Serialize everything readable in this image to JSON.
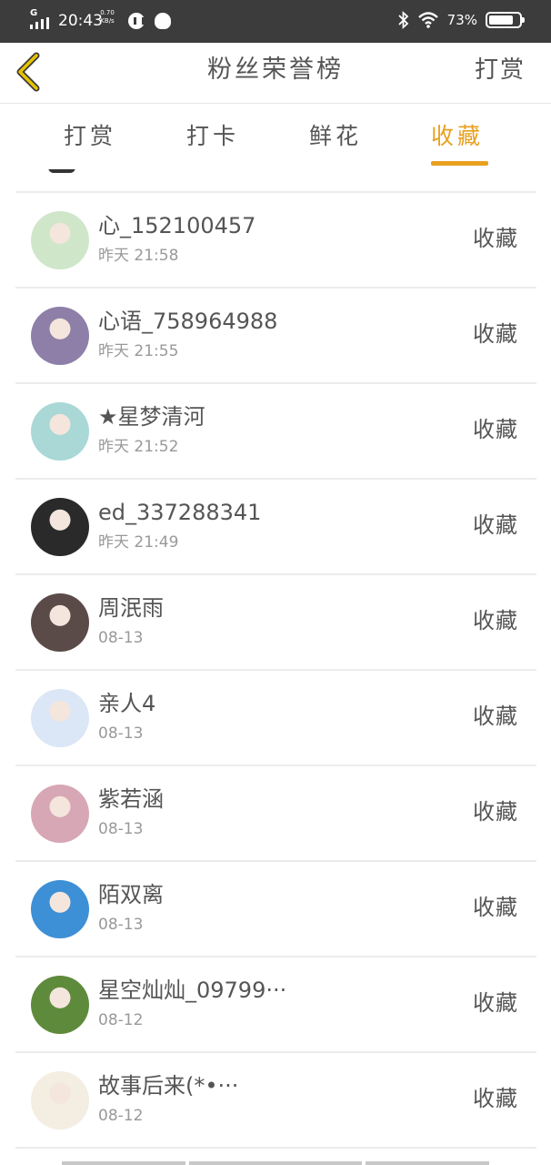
{
  "status_bar": {
    "network": "G",
    "time": "20:43",
    "speed_value": "0.70",
    "speed_unit": "KB/s",
    "battery": "73%"
  },
  "header": {
    "title": "粉丝荣誉榜",
    "action_label": "打赏"
  },
  "tabs": [
    {
      "label": "打赏",
      "active": false
    },
    {
      "label": "打卡",
      "active": false
    },
    {
      "label": "鲜花",
      "active": false
    },
    {
      "label": "收藏",
      "active": true
    }
  ],
  "list": [
    {
      "name": "心_152100457",
      "time": "昨天 21:58",
      "action": "收藏",
      "avatar_color": "#cfe6c9"
    },
    {
      "name": "心语_758964988",
      "time": "昨天 21:55",
      "action": "收藏",
      "avatar_color": "#8e7fa8"
    },
    {
      "name": "★星梦清河",
      "time": "昨天 21:52",
      "action": "收藏",
      "avatar_color": "#a9d8d6"
    },
    {
      "name": "ed_337288341",
      "time": "昨天 21:49",
      "action": "收藏",
      "avatar_color": "#2a2a2a"
    },
    {
      "name": "周泯雨",
      "time": "08-13",
      "action": "收藏",
      "avatar_color": "#5a4a48"
    },
    {
      "name": "亲人4",
      "time": "08-13",
      "action": "收藏",
      "avatar_color": "#dbe7f6"
    },
    {
      "name": "紫若涵",
      "time": "08-13",
      "action": "收藏",
      "avatar_color": "#d8a7b5"
    },
    {
      "name": "陌双离",
      "time": "08-13",
      "action": "收藏",
      "avatar_color": "#3d8fd6"
    },
    {
      "name": "星空灿灿_09799···",
      "time": "08-12",
      "action": "收藏",
      "avatar_color": "#5e8a3c"
    },
    {
      "name": "故事后来(*•···",
      "time": "08-12",
      "action": "收藏",
      "avatar_color": "#f3ede2"
    }
  ],
  "colors": {
    "accent": "#e8a020",
    "back_icon": "#e6c300",
    "status_bar": "#3c3c3c"
  }
}
